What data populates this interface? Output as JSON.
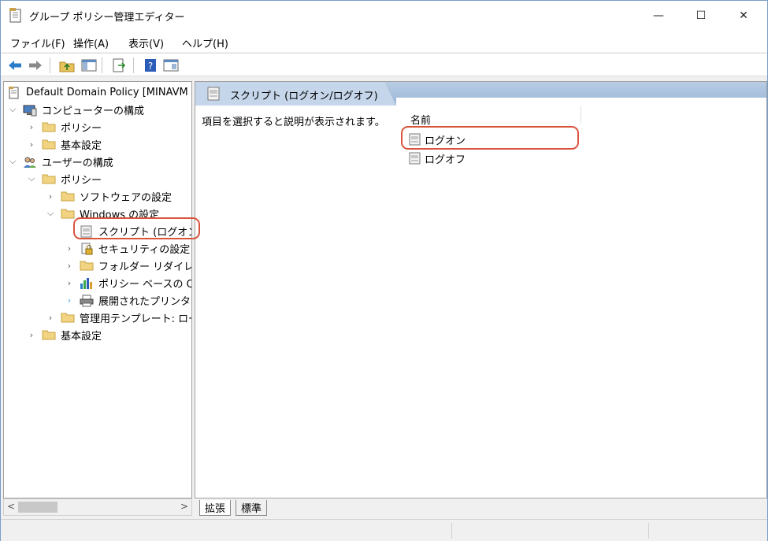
{
  "window": {
    "title": "グループ ポリシー管理エディター",
    "minimize": "—",
    "maximize": "☐",
    "close": "✕"
  },
  "menu": [
    "ファイル(F)",
    "操作(A)",
    "表示(V)",
    "ヘルプ(H)"
  ],
  "tree": [
    {
      "label": "Default Domain Policy [MINAVM",
      "twisty": ""
    },
    {
      "label": "コンピューターの構成",
      "twisty": "⌵"
    },
    {
      "label": "ポリシー",
      "twisty": "›"
    },
    {
      "label": "基本設定",
      "twisty": "›"
    },
    {
      "label": "ユーザーの構成",
      "twisty": "⌵"
    },
    {
      "label": "ポリシー",
      "twisty": "⌵"
    },
    {
      "label": "ソフトウェアの設定",
      "twisty": "›"
    },
    {
      "label": "Windows の設定",
      "twisty": "⌵"
    },
    {
      "label": "スクリプト (ログオン/",
      "twisty": ""
    },
    {
      "label": "セキュリティの設定",
      "twisty": "›"
    },
    {
      "label": "フォルダー リダイレク",
      "twisty": "›"
    },
    {
      "label": "ポリシー ベースの Q",
      "twisty": "›"
    },
    {
      "label": "展開されたプリンター",
      "twisty": "›"
    },
    {
      "label": "管理用テンプレート: ロー",
      "twisty": "›"
    },
    {
      "label": "基本設定",
      "twisty": "›"
    }
  ],
  "right": {
    "header_title": "スクリプト (ログオン/ログオフ)",
    "description": "項目を選択すると説明が表示されます。",
    "column_name": "名前",
    "items": [
      "ログオン",
      "ログオフ"
    ]
  },
  "tabs": [
    "拡張",
    "標準"
  ],
  "scroll": {
    "left": "<",
    "right": ">"
  },
  "colors": {
    "highlight": "#d9533d",
    "header": "#9bb6d6"
  }
}
